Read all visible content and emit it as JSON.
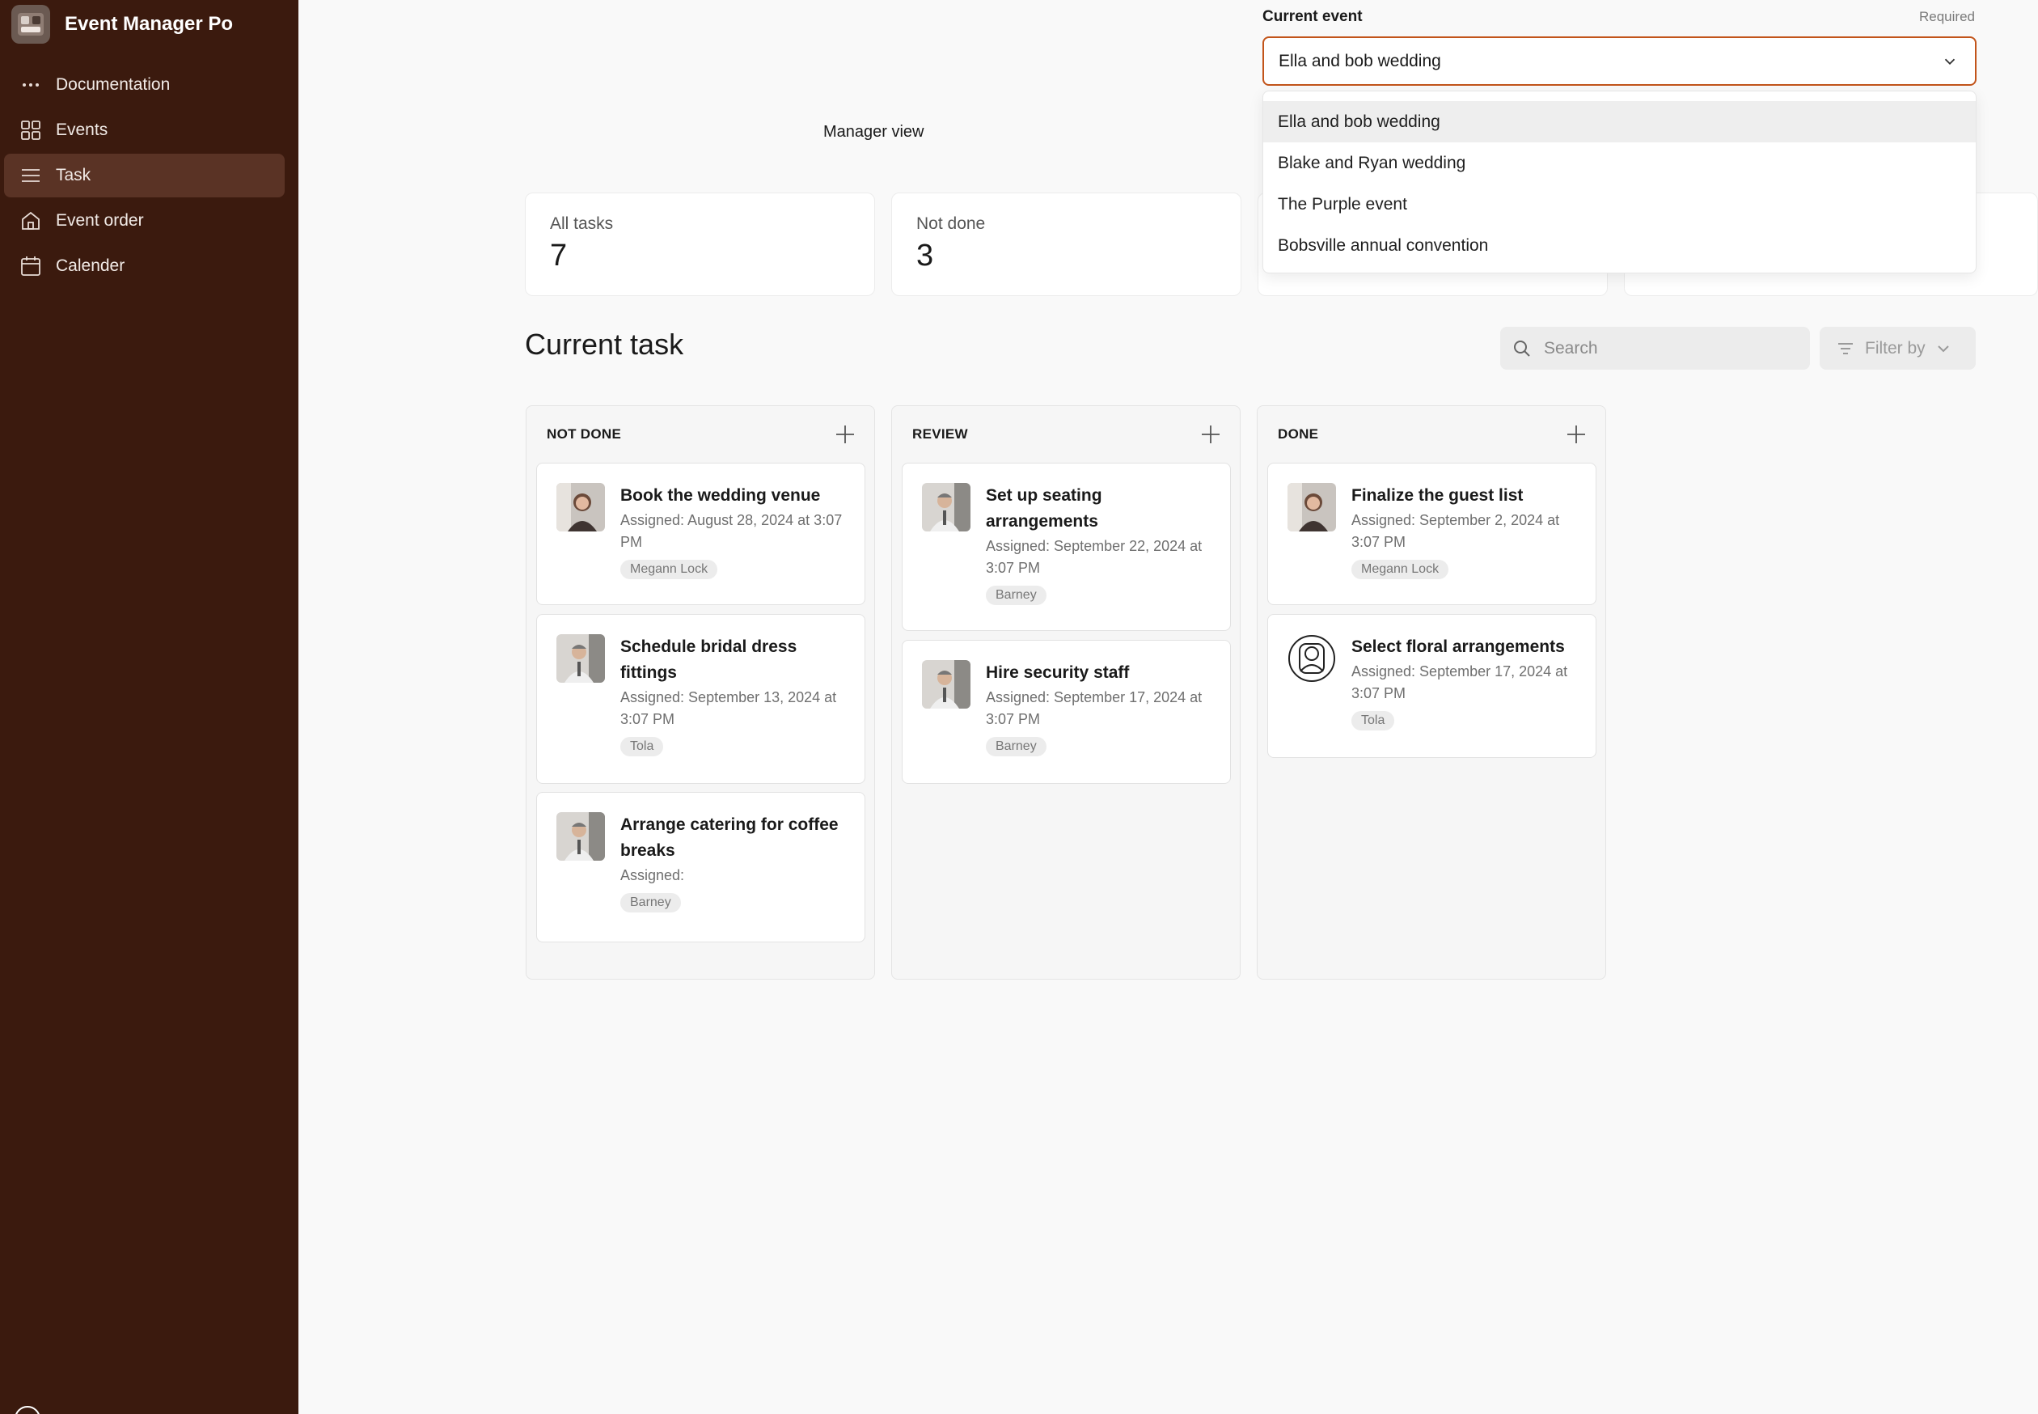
{
  "app": {
    "name": "Event Manager Po"
  },
  "sidebar": {
    "items": [
      {
        "label": "Documentation",
        "icon": "more-dots-icon"
      },
      {
        "label": "Events",
        "icon": "grid-icon"
      },
      {
        "label": "Task",
        "icon": "list-icon",
        "active": true
      },
      {
        "label": "Event order",
        "icon": "home-icon"
      },
      {
        "label": "Calender",
        "icon": "calendar-icon"
      }
    ]
  },
  "event_select": {
    "label": "Current event",
    "required": "Required",
    "value": "Ella and bob wedding",
    "options": [
      "Ella and bob wedding",
      "Blake and Ryan wedding",
      "The Purple event",
      "Bobsville annual convention"
    ]
  },
  "header": {
    "view_label": "Manager view"
  },
  "stats": [
    {
      "label": "All tasks",
      "value": "7"
    },
    {
      "label": "Not done",
      "value": "3"
    }
  ],
  "section": {
    "title": "Current task"
  },
  "search": {
    "placeholder": "Search"
  },
  "filter": {
    "label": "Filter by"
  },
  "board": {
    "columns": [
      {
        "title": "NOT DONE",
        "tasks": [
          {
            "title": "Book the wedding venue",
            "assigned": "Assigned: August 28, 2024 at 3:07 PM",
            "tag": "Megann Lock",
            "avatar": "woman-photo"
          },
          {
            "title": "Schedule bridal dress fittings",
            "assigned": "Assigned: September 13, 2024 at 3:07 PM",
            "tag": "Tola",
            "avatar": "man-photo"
          },
          {
            "title": "Arrange catering for coffee breaks",
            "assigned": "Assigned:",
            "tag": "Barney",
            "avatar": "man-photo"
          }
        ]
      },
      {
        "title": "REVIEW",
        "tasks": [
          {
            "title": "Set up seating arrangements",
            "assigned": "Assigned: September 22, 2024 at 3:07 PM",
            "tag": "Barney",
            "avatar": "man-photo"
          },
          {
            "title": "Hire security staff",
            "assigned": "Assigned: September 17, 2024 at 3:07 PM",
            "tag": "Barney",
            "avatar": "man-photo"
          }
        ]
      },
      {
        "title": "DONE",
        "tasks": [
          {
            "title": "Finalize the guest list",
            "assigned": "Assigned: September 2, 2024 at 3:07 PM",
            "tag": "Megann Lock",
            "avatar": "woman-photo"
          },
          {
            "title": "Select floral arrangements",
            "assigned": "Assigned: September 17, 2024 at 3:07 PM",
            "tag": "Tola",
            "avatar": "user-placeholder-icon"
          }
        ]
      }
    ]
  },
  "colors": {
    "sidebar": "#3b1a0e",
    "accent": "#c2541a",
    "active_nav": "#5a3325"
  }
}
